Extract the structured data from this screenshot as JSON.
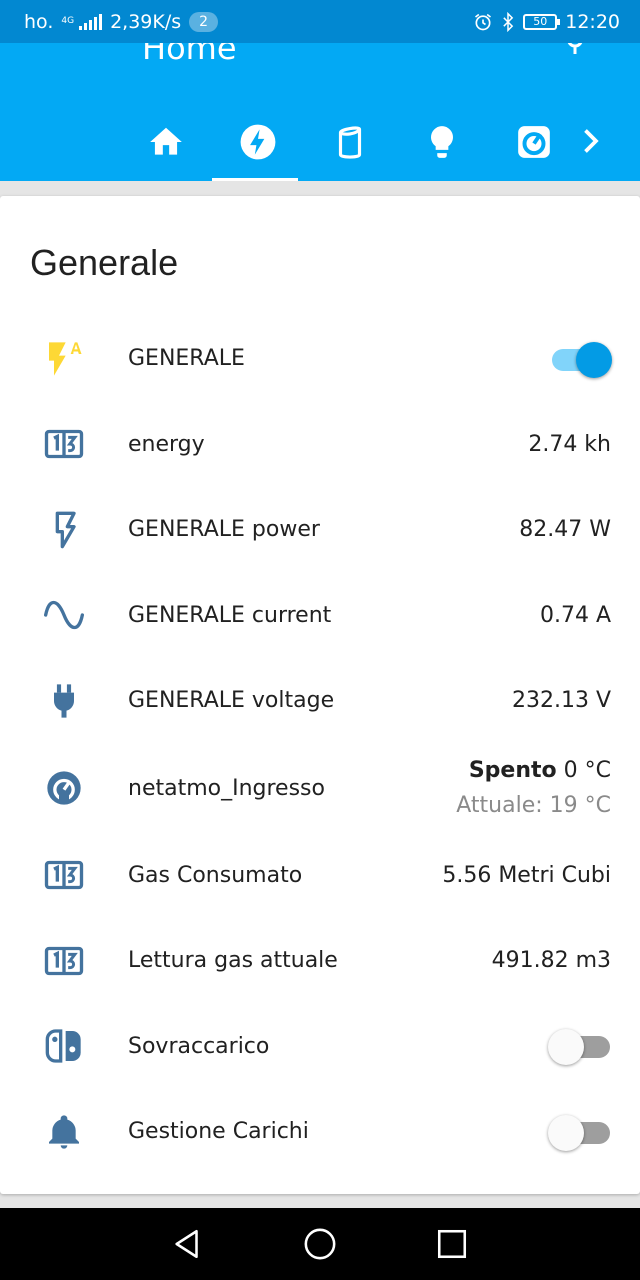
{
  "status_bar": {
    "carrier": "ho.",
    "network": "4G",
    "speed": "2,39K/s",
    "badge": "2",
    "battery": "50",
    "time": "12:20",
    "icons": [
      "alarm-icon",
      "bluetooth-icon",
      "battery-icon"
    ]
  },
  "app_bar": {
    "title": "Home",
    "icons": [
      "menu-icon",
      "microphone-icon"
    ],
    "tabs": [
      {
        "icon": "home-icon",
        "active": false
      },
      {
        "icon": "flash-icon",
        "active": true
      },
      {
        "icon": "cylinder-icon",
        "active": false
      },
      {
        "icon": "lightbulb-icon",
        "active": false
      },
      {
        "icon": "thermostat-icon",
        "active": false
      }
    ],
    "next_icon": "chevron-right-icon"
  },
  "card": {
    "title": "Generale",
    "rows": [
      {
        "icon": "flash-auto-icon",
        "label": "GENERALE",
        "type": "toggle",
        "on": true
      },
      {
        "icon": "counter-icon",
        "label": "energy",
        "value": "2.74 kh"
      },
      {
        "icon": "flash-outline-icon",
        "label": "GENERALE power",
        "value": "82.47 W"
      },
      {
        "icon": "sine-wave-icon",
        "label": "GENERALE current",
        "value": "0.74 A"
      },
      {
        "icon": "power-plug-icon",
        "label": "GENERALE voltage",
        "value": "232.13 V"
      },
      {
        "icon": "thermostat-icon",
        "label": "netatmo_Ingresso",
        "state": "Spento",
        "target": "0 °C",
        "current": "Attuale: 19 °C"
      },
      {
        "icon": "counter-icon",
        "label": "Gas Consumato",
        "value": "5.56 Metri Cubi"
      },
      {
        "icon": "counter-icon",
        "label": "Lettura gas attuale",
        "value": "491.82 m3"
      },
      {
        "icon": "nintendo-switch-icon",
        "label": "Sovraccarico",
        "type": "toggle",
        "on": false
      },
      {
        "icon": "bell-icon",
        "label": "Gestione Carichi",
        "type": "toggle",
        "on": false
      }
    ]
  },
  "colors": {
    "status_bar": "#0288d1",
    "app_bar": "#03a9f4",
    "icon": "#44739e",
    "icon_active": "#fdd835",
    "toggle_on": "#039be5"
  },
  "nav_bar": {
    "icons": [
      "back-icon",
      "home-circle-icon",
      "recents-icon"
    ]
  }
}
